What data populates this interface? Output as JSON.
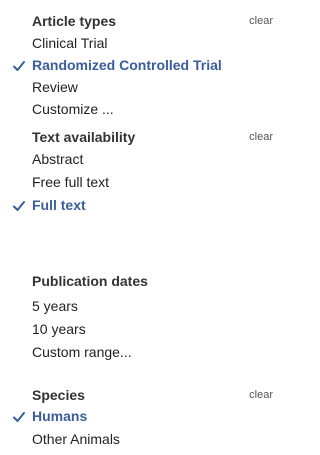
{
  "groups": [
    {
      "title": "Article types",
      "clear_label": "clear",
      "items": [
        {
          "label": "Clinical Trial",
          "selected": false
        },
        {
          "label": "Randomized Controlled Trial",
          "selected": true
        },
        {
          "label": "Review",
          "selected": false
        },
        {
          "label": "Customize ...",
          "selected": false
        }
      ]
    },
    {
      "title": "Text availability",
      "clear_label": "clear",
      "items": [
        {
          "label": "Abstract",
          "selected": false
        },
        {
          "label": "Free full text",
          "selected": false
        },
        {
          "label": "Full text",
          "selected": true
        }
      ]
    },
    {
      "title": "Publication dates",
      "items": [
        {
          "label": "5 years",
          "selected": false
        },
        {
          "label": "10 years",
          "selected": false
        },
        {
          "label": "Custom range...",
          "selected": false
        }
      ]
    },
    {
      "title": "Species",
      "clear_label": "clear",
      "items": [
        {
          "label": "Humans",
          "selected": true
        },
        {
          "label": "Other Animals",
          "selected": false
        }
      ]
    }
  ],
  "colors": {
    "selected_text": "#3a5d9c",
    "checkmark": "#3a5d9c"
  },
  "icons": {
    "selected_marker": "checkmark-icon"
  }
}
